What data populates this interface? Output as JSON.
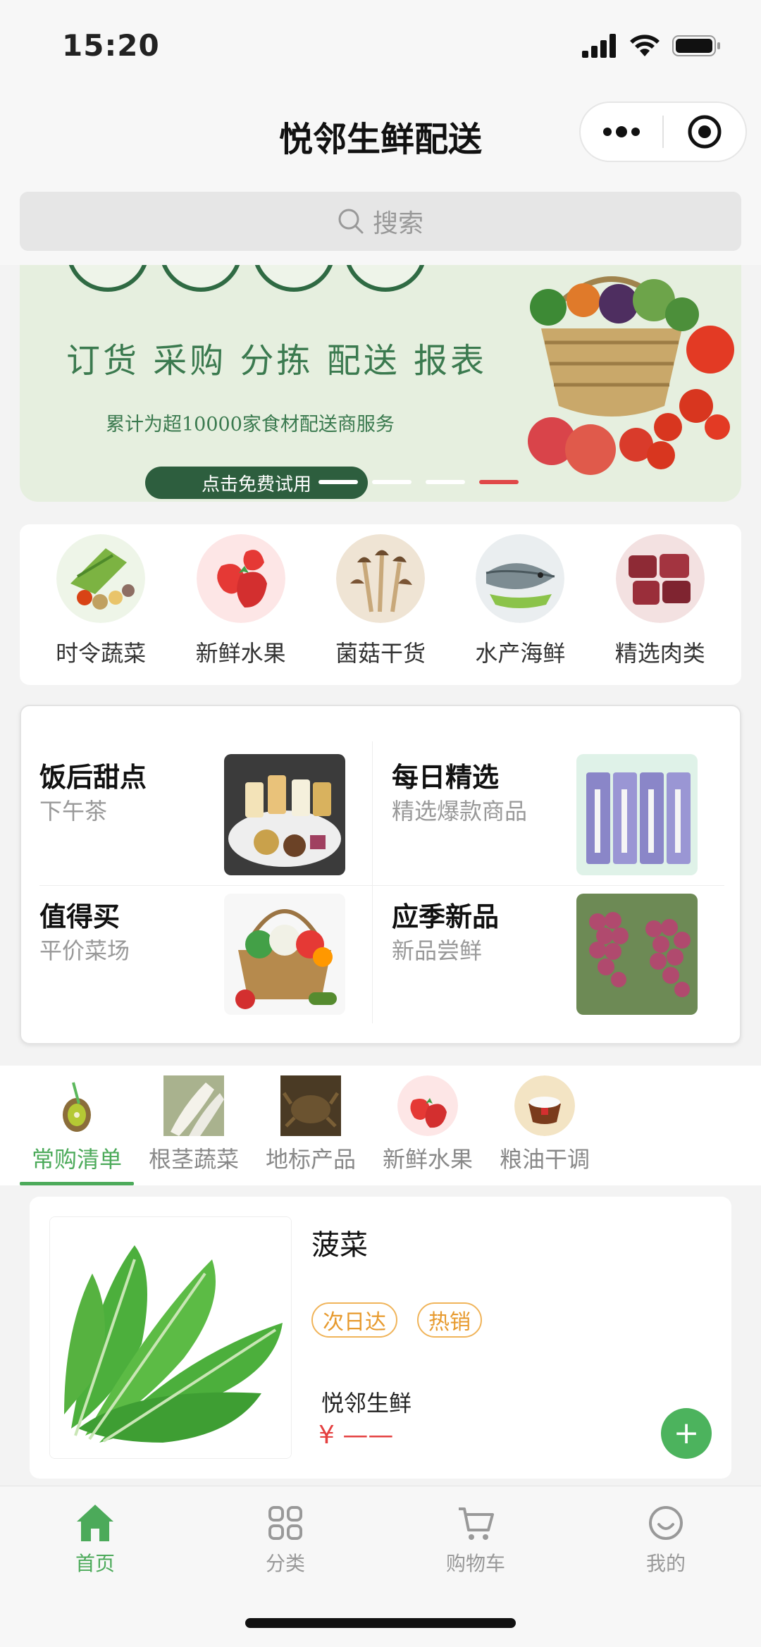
{
  "status_bar": {
    "time": "15:20"
  },
  "navbar": {
    "title": "悦邻生鲜配送"
  },
  "search": {
    "placeholder": "搜索"
  },
  "banner": {
    "headline": "订货 采购 分拣  配送 报表",
    "subline": "累计为超10000家食材配送商服务",
    "cta": "点击免费试用",
    "slide_count": 4,
    "active_slide": 4
  },
  "categories": [
    {
      "label": "时令蔬菜",
      "icon": "vegetables-icon"
    },
    {
      "label": "新鲜水果",
      "icon": "strawberry-icon"
    },
    {
      "label": "菌菇干货",
      "icon": "mushroom-icon"
    },
    {
      "label": "水产海鲜",
      "icon": "fish-icon"
    },
    {
      "label": "精选肉类",
      "icon": "meat-icon"
    }
  ],
  "features": [
    {
      "title": "饭后甜点",
      "subtitle": "下午茶"
    },
    {
      "title": "每日精选",
      "subtitle": "精选爆款商品"
    },
    {
      "title": "值得买",
      "subtitle": "平价菜场"
    },
    {
      "title": "应季新品",
      "subtitle": "新品尝鲜"
    }
  ],
  "tabs": [
    {
      "label": "常购清单",
      "active": true
    },
    {
      "label": "根茎蔬菜",
      "active": false
    },
    {
      "label": "地标产品",
      "active": false
    },
    {
      "label": "新鲜水果",
      "active": false
    },
    {
      "label": "粮油干调",
      "active": false
    }
  ],
  "product": {
    "name": "菠菜",
    "tags": [
      "次日达",
      "热销"
    ],
    "shop": "悦邻生鲜",
    "price": "¥ ——",
    "add_label": "+"
  },
  "tabbar": [
    {
      "label": "首页",
      "icon": "home-icon",
      "active": true
    },
    {
      "label": "分类",
      "icon": "grid-icon",
      "active": false
    },
    {
      "label": "购物车",
      "icon": "cart-icon",
      "active": false
    },
    {
      "label": "我的",
      "icon": "profile-icon",
      "active": false
    }
  ],
  "colors": {
    "accent": "#4caa5a",
    "price": "#e44040",
    "tag": "#e79a2e",
    "banner_dark": "#2d5e3e"
  }
}
